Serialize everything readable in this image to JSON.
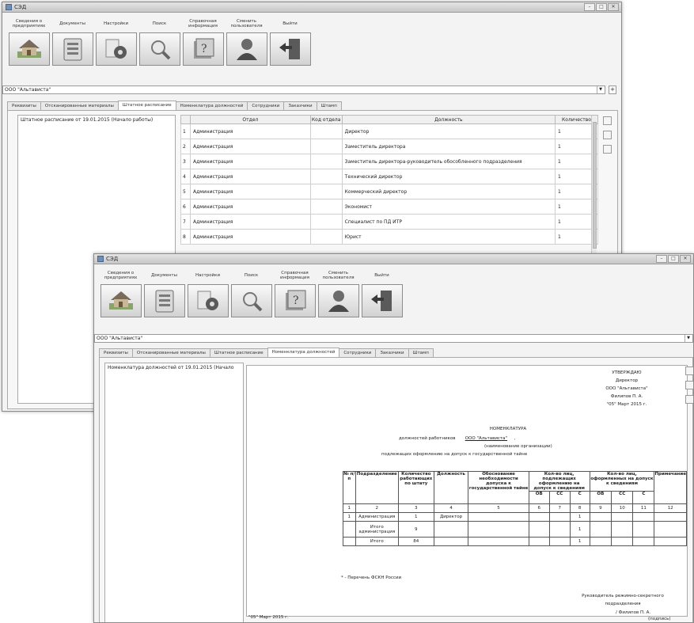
{
  "win1": {
    "title": "СЭД",
    "toolbar": [
      {
        "label": "Сведения о предприятиях",
        "icon": "house-icon"
      },
      {
        "label": "Документы",
        "icon": "documents-icon"
      },
      {
        "label": "Настройки",
        "icon": "gear-icon"
      },
      {
        "label": "Поиск",
        "icon": "magnifier-icon"
      },
      {
        "label": "Справочная информация",
        "icon": "reference-icon"
      },
      {
        "label": "Сменить пользователя",
        "icon": "user-icon"
      },
      {
        "label": "Выйти",
        "icon": "exit-door-icon"
      }
    ],
    "org": "ООО \"Альтависта\"",
    "tabs": [
      "Реквизиты",
      "Отсканированные материалы",
      "Штатное расписание",
      "Номенклатура должностей",
      "Сотрудники",
      "Заказчики",
      "Штамп"
    ],
    "active_tab": "Штатное расписание",
    "list_item": "Штатное расписание от 19.01.2015 (Начало работы)",
    "table": {
      "headers": [
        "",
        "Отдел",
        "Код отдела",
        "Должность",
        "Количество"
      ],
      "rows": [
        {
          "n": "1",
          "dept": "Администрация",
          "code": "",
          "pos": "Директор",
          "qty": "1"
        },
        {
          "n": "2",
          "dept": "Администрация",
          "code": "",
          "pos": "Заместитель директора",
          "qty": "1"
        },
        {
          "n": "3",
          "dept": "Администрация",
          "code": "",
          "pos": "Заместитель директора-руководитель обособленного подразделения",
          "qty": "1"
        },
        {
          "n": "4",
          "dept": "Администрация",
          "code": "",
          "pos": "Технический директор",
          "qty": "1"
        },
        {
          "n": "5",
          "dept": "Администрация",
          "code": "",
          "pos": "Коммерческий директор",
          "qty": "1"
        },
        {
          "n": "6",
          "dept": "Администрация",
          "code": "",
          "pos": "Экономист",
          "qty": "1"
        },
        {
          "n": "7",
          "dept": "Администрация",
          "code": "",
          "pos": "Специалист по ПД ИТР",
          "qty": "1"
        },
        {
          "n": "8",
          "dept": "Администрация",
          "code": "",
          "pos": "Юрист",
          "qty": "1"
        }
      ]
    }
  },
  "win2": {
    "title": "СЭД",
    "org": "ООО \"Альтависта\"",
    "tabs": [
      "Реквизиты",
      "Отсканированные материалы",
      "Штатное расписание",
      "Номенклатура должностей",
      "Сотрудники",
      "Заказчики",
      "Штамп"
    ],
    "active_tab": "Номенклатура должностей",
    "list_item": "Номенклатура должностей от 19.01.2015 (Начало",
    "doc": {
      "approve": [
        "УТВЕРЖДАЮ",
        "Директор",
        "ООО \"Альтависта\"",
        "Филипов П. А.",
        "\"05\" Март 2015 г."
      ],
      "heading": "НОМЕНКЛАТУРА",
      "line1_pre": "должностей работников",
      "line1_org": "ООО \"Альтависта\"",
      "line1_post": ",",
      "line2": "(наименование организации)",
      "line3": "подлежащих оформлению на допуск к государственной тайне",
      "headers": [
        "№ п/п",
        "Подразделение",
        "Количество работающих по штату",
        "Должность",
        "Обоснование необходимости допуска к государственной тайне",
        "Кол-во лиц, подлежащих оформлению на допуск к сведениям",
        "Кол-во лиц, оформленных на допуск к сведениям",
        "Примечание"
      ],
      "sub": [
        "ОВ",
        "СС",
        "С",
        "ОВ",
        "СС",
        "С"
      ],
      "nums": [
        "1",
        "2",
        "3",
        "4",
        "5",
        "6",
        "7",
        "8",
        "9",
        "10",
        "11",
        "12"
      ],
      "row1": {
        "n": "1",
        "dept": "Администрация",
        "qty": "1",
        "pos": "Директор",
        "c": "1"
      },
      "row2": {
        "dept": "Итого администрация",
        "qty": "9",
        "c": "1"
      },
      "row3": {
        "dept": "Итого",
        "qty": "84",
        "c": "1"
      },
      "footnote": "* - Перечень ФСКН России",
      "signer1": "Руководитель режимно-секретного",
      "signer2": "подразделения",
      "signer3": "/ Филипов П. А.",
      "signer4": "(подпись)",
      "date": "\"05\"  Март   2015 г."
    }
  }
}
